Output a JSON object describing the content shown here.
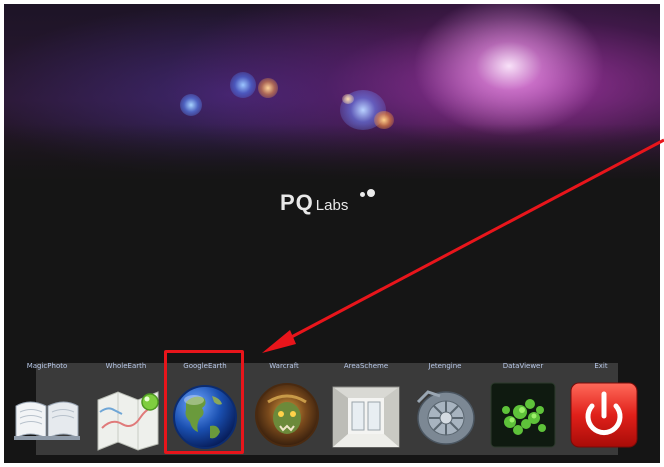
{
  "banner": {
    "logo_text": "PQ",
    "logo_suffix": "Labs"
  },
  "dock": {
    "items": [
      {
        "label": "MagicPhoto",
        "icon": "book-icon"
      },
      {
        "label": "WholeEarth",
        "icon": "map-icon"
      },
      {
        "label": "GoogleEarth",
        "icon": "globe-icon"
      },
      {
        "label": "Warcraft",
        "icon": "warcraft-icon"
      },
      {
        "label": "AreaScheme",
        "icon": "room-icon"
      },
      {
        "label": "Jetengine",
        "icon": "turbine-icon"
      },
      {
        "label": "DataViewer",
        "icon": "particles-icon"
      },
      {
        "label": "Exit",
        "icon": "power-icon"
      }
    ]
  },
  "annotation": {
    "highlight_color": "#e8151b",
    "highlighted_item": "GoogleEarth"
  }
}
